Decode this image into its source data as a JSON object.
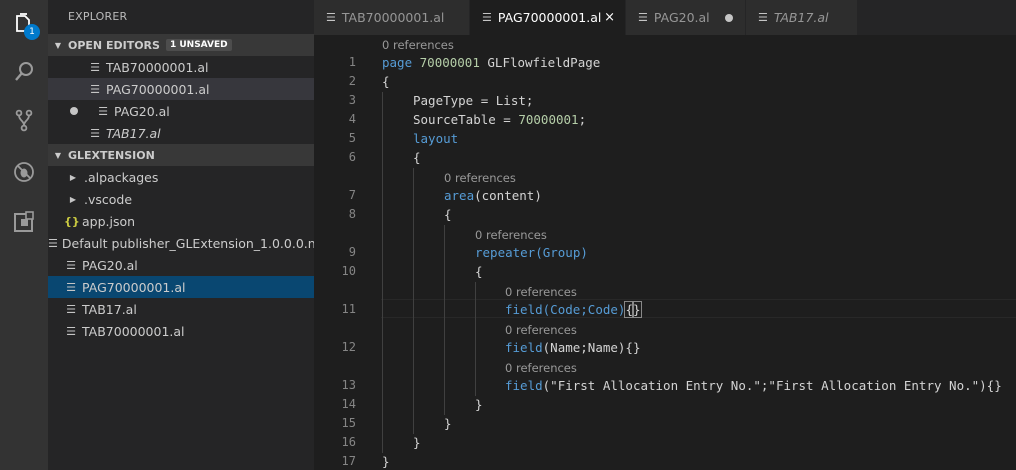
{
  "activity_bar": {
    "badge": "1",
    "icons": [
      "files-icon",
      "search-icon",
      "source-control-icon",
      "debug-icon",
      "extensions-icon"
    ]
  },
  "sidebar": {
    "title": "EXPLORER",
    "open_editors": {
      "header": "OPEN EDITORS",
      "badge": "1 UNSAVED",
      "items": [
        {
          "label": "TAB70000001.al",
          "dirty": false,
          "italic": false
        },
        {
          "label": "PAG70000001.al",
          "dirty": false,
          "italic": false
        },
        {
          "label": "PAG20.al",
          "dirty": true,
          "italic": false
        },
        {
          "label": "TAB17.al",
          "dirty": false,
          "italic": true
        }
      ]
    },
    "workspace": {
      "header": "GLEXTENSION",
      "items": [
        {
          "label": ".alpackages",
          "kind": "folder"
        },
        {
          "label": ".vscode",
          "kind": "folder"
        },
        {
          "label": "app.json",
          "kind": "json"
        },
        {
          "label": "Default publisher_GLExtension_1.0.0.0.n...",
          "kind": "file"
        },
        {
          "label": "PAG20.al",
          "kind": "file"
        },
        {
          "label": "PAG70000001.al",
          "kind": "file"
        },
        {
          "label": "TAB17.al",
          "kind": "file"
        },
        {
          "label": "TAB70000001.al",
          "kind": "file"
        }
      ]
    }
  },
  "tabs": [
    {
      "label": "TAB70000001.al"
    },
    {
      "label": "PAG70000001.al",
      "close": "×"
    },
    {
      "label": "PAG20.al"
    },
    {
      "label": "TAB17.al"
    }
  ],
  "editor": {
    "code_lens": "0 references",
    "line_numbers": [
      "1",
      "2",
      "3",
      "4",
      "5",
      "6",
      "7",
      "8",
      "9",
      "10",
      "11",
      "12",
      "13",
      "14",
      "15",
      "16",
      "17"
    ],
    "lines": {
      "l1_kw": "page",
      "l1_num": "70000001",
      "l1_rest": "GLFlowfieldPage",
      "l2": "{",
      "l3": "PageType = List;",
      "l4_a": "SourceTable = ",
      "l4_num": "70000001",
      "l4_b": ";",
      "l5": "layout",
      "l6": "{",
      "l7_kw": "area",
      "l7_rest": "(content)",
      "l8": "{",
      "l9": "repeater(Group)",
      "l10": "{",
      "l11_kw": "field",
      "l11_rest": "(Code;Code)",
      "l11_brace_open": "{",
      "l11_brace_close": "}",
      "l12_kw": "field",
      "l12_rest": "(Name;Name){}",
      "l13_kw": "field",
      "l13_open": "(",
      "l13_str1": "\"First Allocation Entry No.\"",
      "l13_sep": ";",
      "l13_str2": "\"First Allocation Entry No.\"",
      "l13_close": "){}",
      "l14": "}",
      "l15": "}",
      "l16": "}",
      "l17": "}"
    }
  }
}
